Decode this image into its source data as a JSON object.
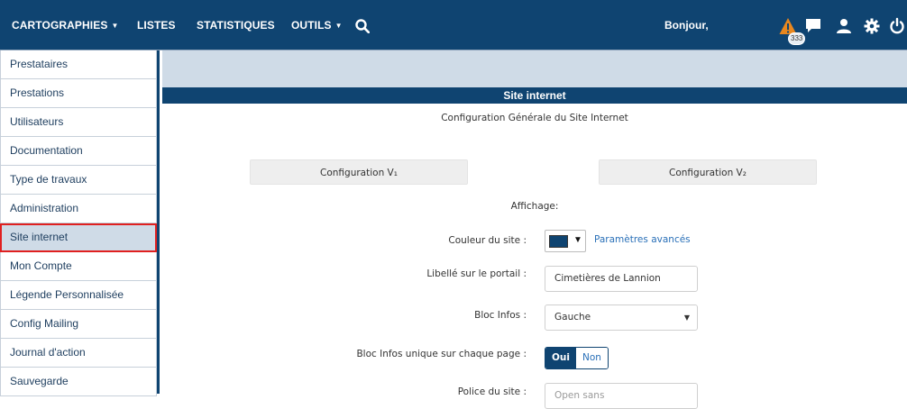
{
  "topbar": {
    "menu": [
      {
        "label": "CARTOGRAPHIES",
        "dropdown": true
      },
      {
        "label": "LISTES",
        "dropdown": false
      },
      {
        "label": "STATISTIQUES",
        "dropdown": false
      },
      {
        "label": "OUTILS",
        "dropdown": true
      }
    ],
    "greeting": "Bonjour,",
    "alert_badge": "333",
    "icons": [
      "search-icon",
      "warning-icon",
      "chat-icon",
      "user-icon",
      "gear-icon",
      "power-icon"
    ]
  },
  "sidebar": {
    "items": [
      {
        "label": "Prestataires"
      },
      {
        "label": "Prestations"
      },
      {
        "label": "Utilisateurs"
      },
      {
        "label": "Documentation"
      },
      {
        "label": "Type de travaux"
      },
      {
        "label": "Administration"
      },
      {
        "label": "Site internet",
        "active": true
      },
      {
        "label": "Mon Compte"
      },
      {
        "label": "Légende Personnalisée"
      },
      {
        "label": "Config Mailing"
      },
      {
        "label": "Journal d'action"
      },
      {
        "label": "Sauvegarde"
      }
    ]
  },
  "section": {
    "title": "Site internet",
    "subtitle": "Configuration Générale du Site Internet",
    "config_v1": "Configuration V₁",
    "config_v2": "Configuration V₂",
    "affichage": "Affichage:"
  },
  "form": {
    "couleur_label": "Couleur du site :",
    "couleur_value": "#0f4471",
    "advanced_link": "Paramètres avancés",
    "libelle_label": "Libellé sur le portail :",
    "libelle_value": "Cimetières de Lannion",
    "bloc_infos_label": "Bloc Infos :",
    "bloc_infos_value": "Gauche",
    "bloc_unique_label": "Bloc Infos unique sur chaque page :",
    "toggle_on": "Oui",
    "toggle_off": "Non",
    "police_label": "Police du site :",
    "police_value": "Open sans"
  },
  "colors": {
    "brand": "#0f4471",
    "sidebar_active_bg": "#cfdbe7",
    "active_outline": "#e02020",
    "link": "#2a70b8",
    "warning": "#e8871e"
  }
}
